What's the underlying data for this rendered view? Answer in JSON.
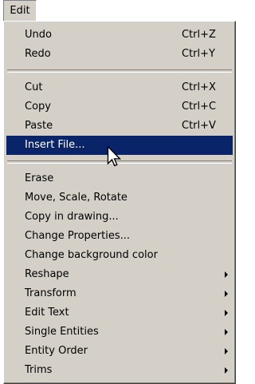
{
  "menubar": {
    "edit_label": "Edit"
  },
  "menu": {
    "group1": [
      {
        "label": "Undo",
        "shortcut": "Ctrl+Z"
      },
      {
        "label": "Redo",
        "shortcut": "Ctrl+Y"
      }
    ],
    "group2": [
      {
        "label": "Cut",
        "shortcut": "Ctrl+X"
      },
      {
        "label": "Copy",
        "shortcut": "Ctrl+C"
      },
      {
        "label": "Paste",
        "shortcut": "Ctrl+V"
      },
      {
        "label": "Insert File..."
      }
    ],
    "group3": [
      {
        "label": "Erase"
      },
      {
        "label": "Move, Scale, Rotate"
      },
      {
        "label": "Copy in drawing..."
      },
      {
        "label": "Change Properties..."
      },
      {
        "label": "Change background color"
      },
      {
        "label": "Reshape"
      },
      {
        "label": "Transform"
      },
      {
        "label": "Edit Text"
      },
      {
        "label": "Single Entities"
      },
      {
        "label": "Entity Order"
      },
      {
        "label": "Trims"
      }
    ]
  },
  "colors": {
    "menu_bg": "#d4d0c8",
    "highlight": "#0a246a"
  },
  "icons": {
    "cursor": "arrow-pointer-icon",
    "submenu": "submenu-arrow-icon"
  }
}
